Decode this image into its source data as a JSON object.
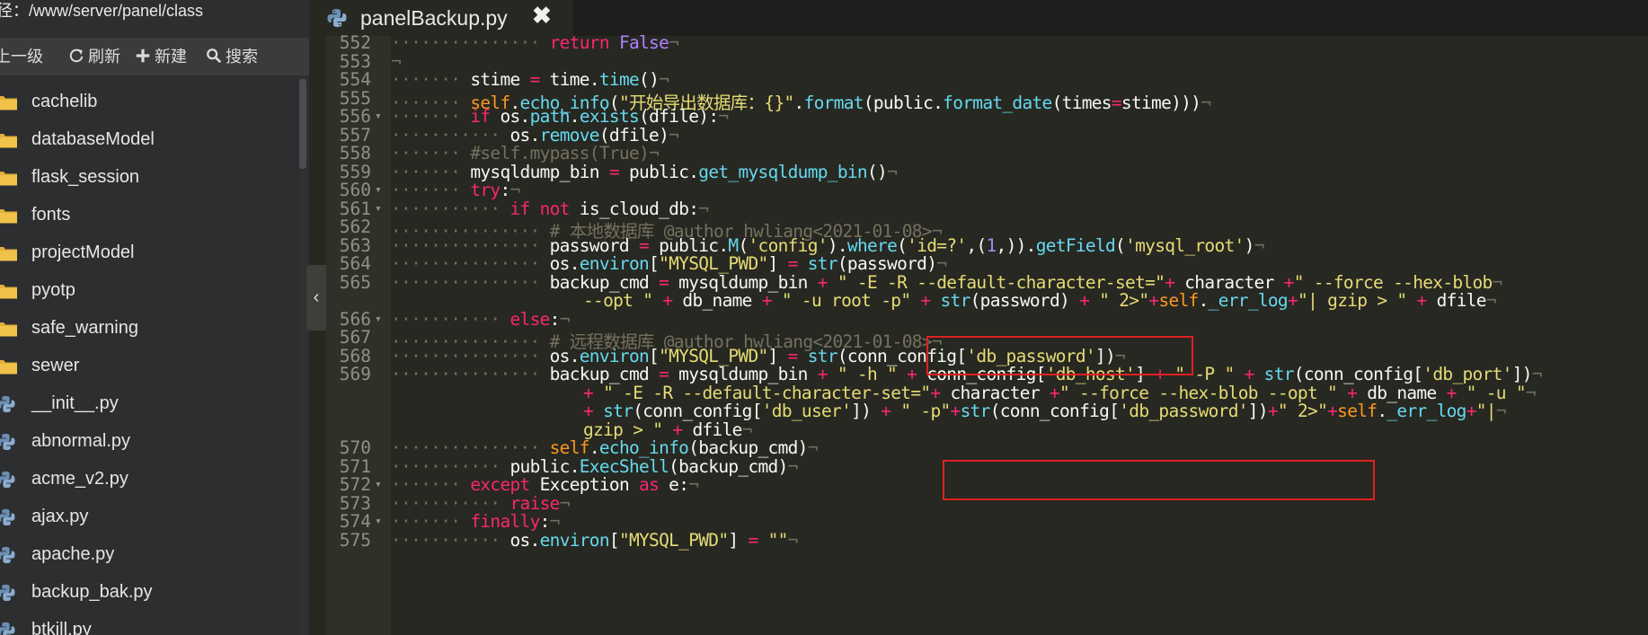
{
  "file_panel": {
    "path_text": "路径：/www/server/panel/class",
    "toolbar": {
      "up_label": "上一级",
      "refresh_label": "刷新",
      "new_label": "新建",
      "search_label": "搜索"
    },
    "items": [
      {
        "name": "cachelib",
        "type": "folder"
      },
      {
        "name": "databaseModel",
        "type": "folder"
      },
      {
        "name": "flask_session",
        "type": "folder"
      },
      {
        "name": "fonts",
        "type": "folder"
      },
      {
        "name": "projectModel",
        "type": "folder"
      },
      {
        "name": "pyotp",
        "type": "folder"
      },
      {
        "name": "safe_warning",
        "type": "folder"
      },
      {
        "name": "sewer",
        "type": "folder"
      },
      {
        "name": "__init__.py",
        "type": "python"
      },
      {
        "name": "abnormal.py",
        "type": "python"
      },
      {
        "name": "acme_v2.py",
        "type": "python"
      },
      {
        "name": "ajax.py",
        "type": "python"
      },
      {
        "name": "apache.py",
        "type": "python"
      },
      {
        "name": "backup_bak.py",
        "type": "python"
      },
      {
        "name": "btkill.py",
        "type": "python"
      }
    ]
  },
  "editor": {
    "tab": {
      "label": "panelBackup.py",
      "close_symbol": "✖"
    },
    "collapse_symbol": "‹",
    "lines": [
      {
        "num": "552",
        "fold": false,
        "indent": 4,
        "tokens": [
          [
            "kw",
            "return"
          ],
          [
            "t",
            " "
          ],
          [
            "bool",
            "False"
          ]
        ]
      },
      {
        "num": "553",
        "fold": false,
        "indent": 0,
        "tokens": []
      },
      {
        "num": "554",
        "fold": false,
        "indent": 2,
        "tokens": [
          [
            "t",
            "stime"
          ],
          [
            "t",
            " "
          ],
          [
            "op",
            "="
          ],
          [
            "t",
            " time."
          ],
          [
            "fn",
            "time"
          ],
          [
            "t",
            "()"
          ]
        ]
      },
      {
        "num": "555",
        "fold": false,
        "indent": 2,
        "tokens": [
          [
            "fn",
            "self"
          ],
          [
            "t",
            "."
          ],
          [
            "fn",
            "echo_info"
          ],
          [
            "t",
            "("
          ],
          [
            "str",
            "\"开始导出数据库：{}\""
          ],
          [
            "t",
            "."
          ],
          [
            "fn",
            "format"
          ],
          [
            "t",
            "(public."
          ],
          [
            "fn",
            "format_date"
          ],
          [
            "t",
            "(times"
          ],
          [
            "op",
            "="
          ],
          [
            "t",
            "stime)))"
          ]
        ]
      },
      {
        "num": "556",
        "fold": true,
        "indent": 2,
        "tokens": [
          [
            "kw",
            "if"
          ],
          [
            "t",
            " os."
          ],
          [
            "fn",
            "path"
          ],
          [
            "t",
            "."
          ],
          [
            "fn",
            "exists"
          ],
          [
            "t",
            "(dfile):"
          ]
        ]
      },
      {
        "num": "557",
        "fold": false,
        "indent": 3,
        "tokens": [
          [
            "t",
            "os."
          ],
          [
            "fn",
            "remove"
          ],
          [
            "t",
            "(dfile)"
          ]
        ]
      },
      {
        "num": "558",
        "fold": false,
        "indent": 2,
        "tokens": [
          [
            "cm",
            "#self.mypass(True)"
          ]
        ]
      },
      {
        "num": "559",
        "fold": false,
        "indent": 2,
        "tokens": [
          [
            "t",
            "mysqldump_bin"
          ],
          [
            "t",
            " "
          ],
          [
            "op",
            "="
          ],
          [
            "t",
            " public."
          ],
          [
            "fn",
            "get_mysqldump_bin"
          ],
          [
            "t",
            "()"
          ]
        ]
      },
      {
        "num": "560",
        "fold": true,
        "indent": 2,
        "tokens": [
          [
            "kw",
            "try"
          ],
          [
            "t",
            ":"
          ]
        ]
      },
      {
        "num": "561",
        "fold": true,
        "indent": 3,
        "tokens": [
          [
            "kw",
            "if"
          ],
          [
            "t",
            " "
          ],
          [
            "kw",
            "not"
          ],
          [
            "t",
            " is_cloud_db:"
          ]
        ]
      },
      {
        "num": "562",
        "fold": false,
        "indent": 4,
        "tokens": [
          [
            "cm",
            "# 本地数据库 @author hwliang<2021-01-08>"
          ]
        ]
      },
      {
        "num": "563",
        "fold": false,
        "indent": 4,
        "tokens": [
          [
            "t",
            "password"
          ],
          [
            "t",
            " "
          ],
          [
            "op",
            "="
          ],
          [
            "t",
            " public."
          ],
          [
            "fn",
            "M"
          ],
          [
            "t",
            "("
          ],
          [
            "str",
            "'config'"
          ],
          [
            "t",
            ")."
          ],
          [
            "fn",
            "where"
          ],
          [
            "t",
            "("
          ],
          [
            "str",
            "'id=?'"
          ],
          [
            "t",
            ",("
          ],
          [
            "num",
            "1"
          ],
          [
            "t",
            ",))."
          ],
          [
            "fn",
            "getField"
          ],
          [
            "t",
            "("
          ],
          [
            "str",
            "'mysql_root'"
          ],
          [
            "t",
            ")"
          ]
        ]
      },
      {
        "num": "564",
        "fold": false,
        "indent": 4,
        "tokens": [
          [
            "t",
            "os."
          ],
          [
            "fn",
            "environ"
          ],
          [
            "t",
            "["
          ],
          [
            "str",
            "\"MYSQL_PWD\""
          ],
          [
            "t",
            "] "
          ],
          [
            "op",
            "="
          ],
          [
            "t",
            " "
          ],
          [
            "fn",
            "str"
          ],
          [
            "t",
            "(password)"
          ]
        ]
      },
      {
        "num": "565",
        "fold": false,
        "indent": 4,
        "tokens": [
          [
            "t",
            "backup_cmd"
          ],
          [
            "t",
            " "
          ],
          [
            "op",
            "="
          ],
          [
            "t",
            " mysqldump_bin "
          ],
          [
            "op",
            "+"
          ],
          [
            "t",
            " "
          ],
          [
            "str",
            "\" -E -R --default-character-set=\""
          ],
          [
            "op",
            "+"
          ],
          [
            "t",
            " character "
          ],
          [
            "op",
            "+"
          ],
          [
            "str",
            "\" --force --hex-blob"
          ]
        ]
      },
      {
        "num": "",
        "fold": false,
        "indent": 5,
        "wrap": true,
        "tokens": [
          [
            "str",
            "--opt \""
          ],
          [
            "t",
            " "
          ],
          [
            "op",
            "+"
          ],
          [
            "t",
            " db_name "
          ],
          [
            "op",
            "+"
          ],
          [
            "t",
            " "
          ],
          [
            "str",
            "\" -u root -p\""
          ],
          [
            "t",
            " "
          ],
          [
            "op",
            "+"
          ],
          [
            "t",
            " "
          ],
          [
            "fn",
            "str"
          ],
          [
            "t",
            "(password) "
          ],
          [
            "op",
            "+"
          ],
          [
            "t",
            " "
          ],
          [
            "str",
            "\" 2>\""
          ],
          [
            "op",
            "+"
          ],
          [
            "fn",
            "self"
          ],
          [
            "t",
            "."
          ],
          [
            "fn",
            "_err_log"
          ],
          [
            "op",
            "+"
          ],
          [
            "str",
            "\"| gzip > \""
          ],
          [
            "t",
            " "
          ],
          [
            "op",
            "+"
          ],
          [
            "t",
            " dfile"
          ]
        ]
      },
      {
        "num": "566",
        "fold": true,
        "indent": 3,
        "tokens": [
          [
            "kw",
            "else"
          ],
          [
            "t",
            ":"
          ]
        ]
      },
      {
        "num": "567",
        "fold": false,
        "indent": 4,
        "tokens": [
          [
            "cm",
            "# 远程数据库 @author hwliang<2021-01-08>"
          ]
        ]
      },
      {
        "num": "568",
        "fold": false,
        "indent": 4,
        "tokens": [
          [
            "t",
            "os."
          ],
          [
            "fn",
            "environ"
          ],
          [
            "t",
            "["
          ],
          [
            "str",
            "\"MYSQL_PWD\""
          ],
          [
            "t",
            "] "
          ],
          [
            "op",
            "="
          ],
          [
            "t",
            " "
          ],
          [
            "fn",
            "str"
          ],
          [
            "t",
            "(conn_config["
          ],
          [
            "str",
            "'db_password'"
          ],
          [
            "t",
            "])"
          ]
        ]
      },
      {
        "num": "569",
        "fold": false,
        "indent": 4,
        "tokens": [
          [
            "t",
            "backup_cmd"
          ],
          [
            "t",
            " "
          ],
          [
            "op",
            "="
          ],
          [
            "t",
            " mysqldump_bin "
          ],
          [
            "op",
            "+"
          ],
          [
            "t",
            " "
          ],
          [
            "str",
            "\" -h \""
          ],
          [
            "t",
            " "
          ],
          [
            "op",
            "+"
          ],
          [
            "t",
            " conn_config["
          ],
          [
            "str",
            "'db_host'"
          ],
          [
            "t",
            "] "
          ],
          [
            "op",
            "+"
          ],
          [
            "t",
            " "
          ],
          [
            "str",
            "\" -P \""
          ],
          [
            "t",
            " "
          ],
          [
            "op",
            "+"
          ],
          [
            "t",
            " "
          ],
          [
            "fn",
            "str"
          ],
          [
            "t",
            "(conn_config["
          ],
          [
            "str",
            "'db_port'"
          ],
          [
            "t",
            "])"
          ]
        ]
      },
      {
        "num": "",
        "fold": false,
        "indent": 5,
        "wrap": true,
        "tokens": [
          [
            "op",
            "+"
          ],
          [
            "t",
            " "
          ],
          [
            "str",
            "\" -E -R --default-character-set=\""
          ],
          [
            "op",
            "+"
          ],
          [
            "t",
            " character "
          ],
          [
            "op",
            "+"
          ],
          [
            "str",
            "\" --force --hex-blob --opt \""
          ],
          [
            "t",
            " "
          ],
          [
            "op",
            "+"
          ],
          [
            "t",
            " db_name "
          ],
          [
            "op",
            "+"
          ],
          [
            "t",
            " "
          ],
          [
            "str",
            "\" -u \""
          ]
        ]
      },
      {
        "num": "",
        "fold": false,
        "indent": 5,
        "wrap": true,
        "tokens": [
          [
            "op",
            "+"
          ],
          [
            "t",
            " "
          ],
          [
            "fn",
            "str"
          ],
          [
            "t",
            "(conn_config["
          ],
          [
            "str",
            "'db_user'"
          ],
          [
            "t",
            "]) "
          ],
          [
            "op",
            "+"
          ],
          [
            "t",
            " "
          ],
          [
            "str",
            "\" -p\""
          ],
          [
            "op",
            "+"
          ],
          [
            "fn",
            "str"
          ],
          [
            "t",
            "(conn_config["
          ],
          [
            "str",
            "'db_password'"
          ],
          [
            "t",
            "])"
          ],
          [
            "op",
            "+"
          ],
          [
            "str",
            "\" 2>\""
          ],
          [
            "op",
            "+"
          ],
          [
            "fn",
            "self"
          ],
          [
            "t",
            "."
          ],
          [
            "fn",
            "_err_log"
          ],
          [
            "op",
            "+"
          ],
          [
            "str",
            "\"|"
          ]
        ]
      },
      {
        "num": "",
        "fold": false,
        "indent": 5,
        "wrap": true,
        "tokens": [
          [
            "str",
            "gzip > \""
          ],
          [
            "t",
            " "
          ],
          [
            "op",
            "+"
          ],
          [
            "t",
            " dfile"
          ]
        ]
      },
      {
        "num": "570",
        "fold": false,
        "indent": 4,
        "tokens": [
          [
            "fn",
            "self"
          ],
          [
            "t",
            "."
          ],
          [
            "fn",
            "echo_info"
          ],
          [
            "t",
            "(backup_cmd)"
          ]
        ]
      },
      {
        "num": "571",
        "fold": false,
        "indent": 3,
        "tokens": [
          [
            "t",
            "public."
          ],
          [
            "fn",
            "ExecShell"
          ],
          [
            "t",
            "(backup_cmd)"
          ]
        ]
      },
      {
        "num": "572",
        "fold": true,
        "indent": 2,
        "tokens": [
          [
            "kw",
            "except"
          ],
          [
            "t",
            " Exception "
          ],
          [
            "kw",
            "as"
          ],
          [
            "t",
            " e:"
          ]
        ]
      },
      {
        "num": "573",
        "fold": false,
        "indent": 3,
        "tokens": [
          [
            "kw",
            "raise"
          ]
        ]
      },
      {
        "num": "574",
        "fold": true,
        "indent": 2,
        "tokens": [
          [
            "kw",
            "finally"
          ],
          [
            "t",
            ":"
          ]
        ]
      },
      {
        "num": "575",
        "fold": false,
        "indent": 3,
        "tokens": [
          [
            "t",
            "os."
          ],
          [
            "fn",
            "environ"
          ],
          [
            "t",
            "["
          ],
          [
            "str",
            "\"MYSQL_PWD\""
          ],
          [
            "t",
            "] "
          ],
          [
            "op",
            "="
          ],
          [
            "t",
            " "
          ],
          [
            "str",
            "\"\""
          ]
        ]
      }
    ],
    "colors": {
      "background": "#272822",
      "keyword": "#f92672",
      "string": "#e6db74",
      "function": "#66d9ef",
      "self": "#fd971f",
      "comment": "#75715e",
      "number": "#ae81ff",
      "highlight_box": "#e02020"
    }
  }
}
